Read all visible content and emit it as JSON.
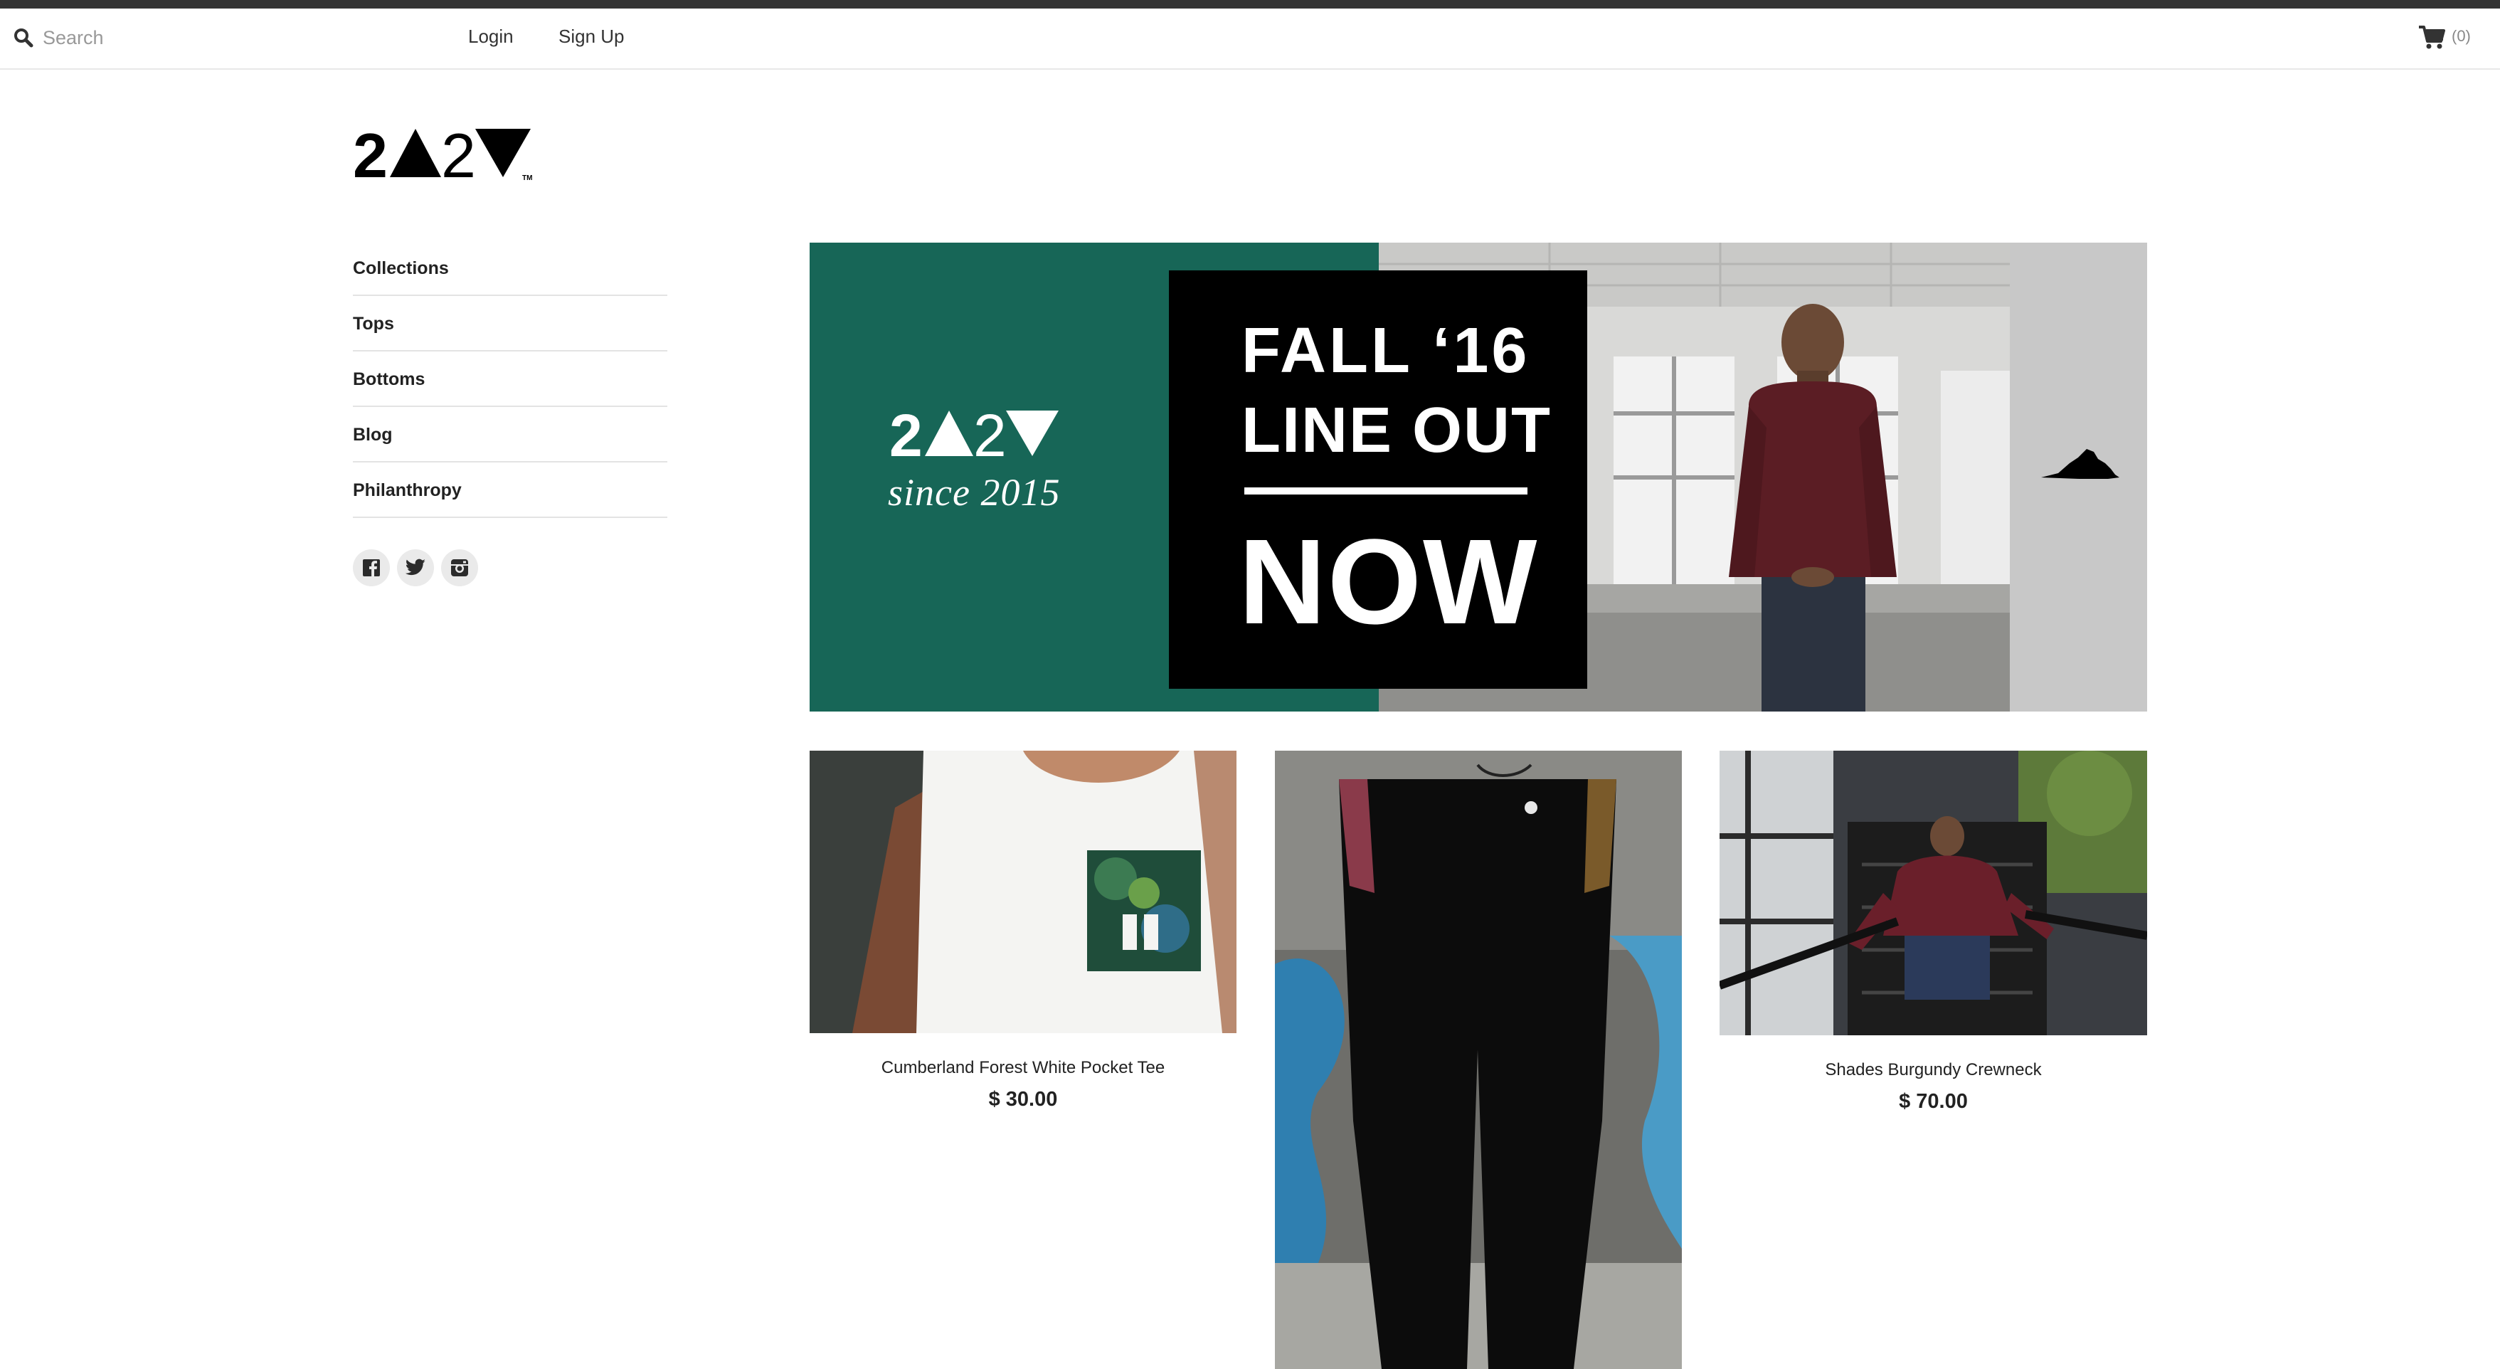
{
  "header": {
    "search_placeholder": "Search",
    "login_label": "Login",
    "signup_label": "Sign Up",
    "cart_count": "(0)"
  },
  "brand": {
    "logo_text": "2▲2▼",
    "trademark": "TM"
  },
  "sidebar": {
    "items": [
      {
        "label": "Collections"
      },
      {
        "label": "Tops"
      },
      {
        "label": "Bottoms"
      },
      {
        "label": "Blog"
      },
      {
        "label": "Philanthropy"
      }
    ],
    "social": [
      "facebook-icon",
      "twitter-icon",
      "instagram-icon"
    ]
  },
  "hero": {
    "line1": "FALL  ‘16",
    "line2": "LINE OUT",
    "line3": "NOW",
    "since": "since 2015",
    "colors": {
      "green": "#176657",
      "black": "#000000",
      "gray": "#c8c8c8"
    }
  },
  "products": [
    {
      "title": "Cumberland Forest White Pocket Tee",
      "price": "$ 30.00"
    },
    {
      "title": "",
      "price": ""
    },
    {
      "title": "Shades Burgundy Crewneck",
      "price": "$ 70.00"
    }
  ]
}
